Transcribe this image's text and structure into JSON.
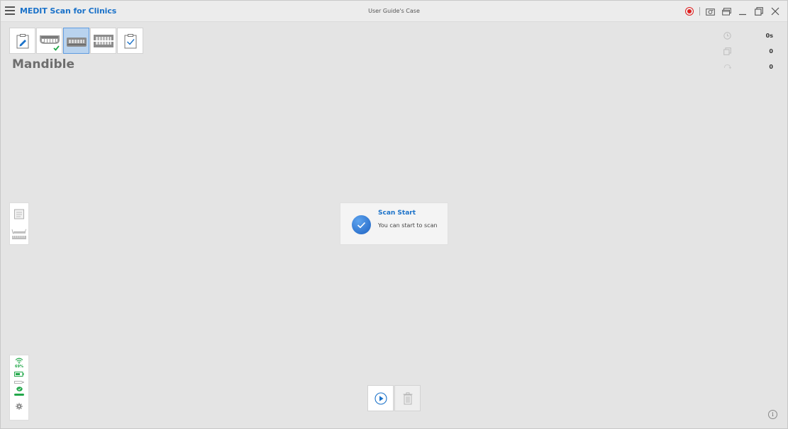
{
  "app": {
    "title": "MEDIT Scan for Clinics",
    "case_title": "User Guide's Case",
    "accent_color": "#1b72c9",
    "record_color": "#e02020"
  },
  "window_controls": [
    {
      "name": "record-button",
      "icon": "record-icon"
    },
    {
      "name": "screenshot-button",
      "icon": "camera-icon"
    },
    {
      "name": "layout-button",
      "icon": "windows-icon"
    },
    {
      "name": "minimize-button",
      "icon": "minimize-icon"
    },
    {
      "name": "restore-button",
      "icon": "restore-icon"
    },
    {
      "name": "close-button",
      "icon": "close-icon"
    }
  ],
  "steps": [
    {
      "name": "step-prep",
      "icon": "clipboard-pencil-icon",
      "active": false,
      "done": false
    },
    {
      "name": "step-maxilla",
      "icon": "maxilla-icon",
      "active": false,
      "done": true
    },
    {
      "name": "step-mandible",
      "icon": "mandible-icon",
      "active": true,
      "done": false
    },
    {
      "name": "step-occlusion",
      "icon": "occlusion-icon",
      "active": false,
      "done": false
    },
    {
      "name": "step-complete",
      "icon": "clipboard-check-icon",
      "active": false,
      "done": false
    }
  ],
  "stage_label": "Mandible",
  "stats": {
    "time": "0s",
    "shots": "0",
    "rotations": "0"
  },
  "toast": {
    "title": "Scan Start",
    "message": "You can start to scan"
  },
  "scanner_status": {
    "battery_percent": "69%",
    "status_color": "#22a84a"
  }
}
